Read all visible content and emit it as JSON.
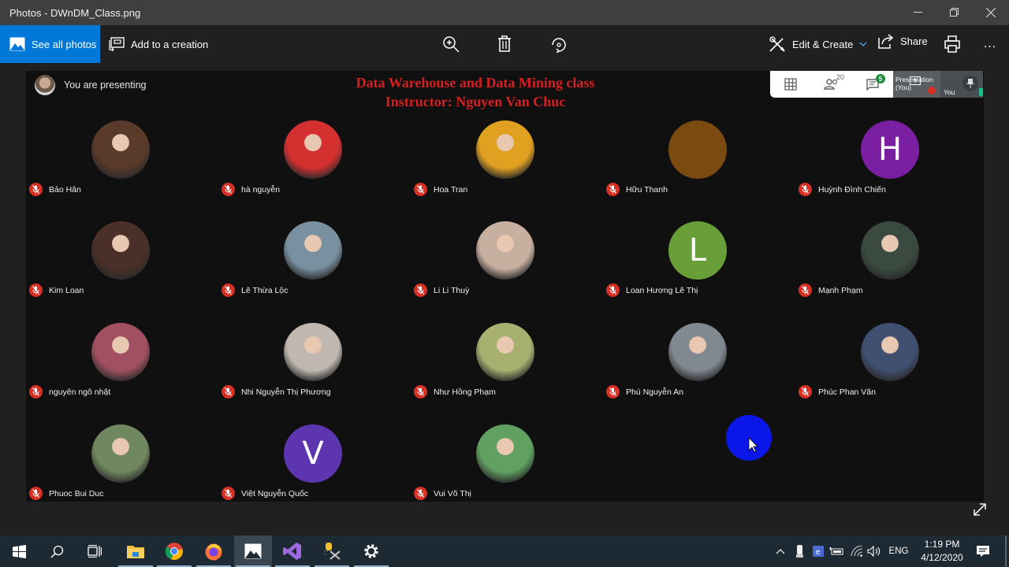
{
  "window": {
    "title": "Photos - DWnDM_Class.png",
    "controls": {
      "minimize": "minimize",
      "restore": "restore",
      "close": "close"
    }
  },
  "toolbar": {
    "see_all_photos": "See all photos",
    "add_to_creation": "Add to a creation",
    "zoom_icon": "zoom-in",
    "delete_icon": "trash",
    "rotate_icon": "rotate",
    "edit_create": "Edit & Create",
    "share": "Share",
    "print_icon": "printer",
    "more": "..."
  },
  "meeting": {
    "presenting_text": "You are presenting",
    "slide_title_line1": "Data Warehouse and Data Mining class",
    "slide_title_line2": "Instructor: Nguyen Van Chuc",
    "participants_count": "20",
    "chat_badge": "5",
    "presentation_tile_line1": "Presentation",
    "presentation_tile_line2": "(You)",
    "you_tile": "You",
    "participants": [
      {
        "name": "Bảo Hân",
        "type": "photo",
        "color": "#5a3a2a"
      },
      {
        "name": "hà nguyễn",
        "type": "photo",
        "color": "#d43030"
      },
      {
        "name": "Hoa Tran",
        "type": "photo",
        "color": "#e0a020"
      },
      {
        "name": "Hữu Thanh",
        "type": "solid",
        "color": "#7b4a10",
        "initial": ""
      },
      {
        "name": "Huỳnh Đình Chiến",
        "type": "initial",
        "color": "#7b1fa2",
        "initial": "H"
      },
      {
        "name": "Kim Loan",
        "type": "photo",
        "color": "#4a3028"
      },
      {
        "name": "Lê Thừa Lộc",
        "type": "photo",
        "color": "#7890a0"
      },
      {
        "name": "Li Li Thuỳ",
        "type": "photo",
        "color": "#c8b0a0"
      },
      {
        "name": "Loan Hương Lê Thị",
        "type": "initial",
        "color": "#689f38",
        "initial": "L"
      },
      {
        "name": "Mạnh Phạm",
        "type": "photo",
        "color": "#3a4a40"
      },
      {
        "name": "nguyên ngô nhật",
        "type": "photo",
        "color": "#a05060"
      },
      {
        "name": "Nhi Nguyễn Thị Phương",
        "type": "photo",
        "color": "#c0b8b0"
      },
      {
        "name": "Như Hồng Phạm",
        "type": "photo",
        "color": "#a8b070"
      },
      {
        "name": "Phú Nguyễn An",
        "type": "photo",
        "color": "#808890"
      },
      {
        "name": "Phúc Phan Văn",
        "type": "photo",
        "color": "#405070"
      },
      {
        "name": "Phuoc Bui Duc",
        "type": "photo",
        "color": "#708860"
      },
      {
        "name": "Việt Nguyễn Quốc",
        "type": "initial",
        "color": "#5e35b1",
        "initial": "V"
      },
      {
        "name": "Vui Võ Thị",
        "type": "photo",
        "color": "#60a060"
      }
    ]
  },
  "taskbar": {
    "apps": [
      "start",
      "search",
      "task-view",
      "file-explorer",
      "chrome",
      "firefox",
      "photos",
      "visual-studio",
      "sql-tools",
      "settings"
    ],
    "tray_language": "ENG",
    "time": "1:19 PM",
    "date": "4/12/2020"
  },
  "colors": {
    "accent": "#0078d7",
    "mic_off": "#d93025",
    "slide_title": "#d42020",
    "cursor_highlight": "#0a17e8"
  }
}
